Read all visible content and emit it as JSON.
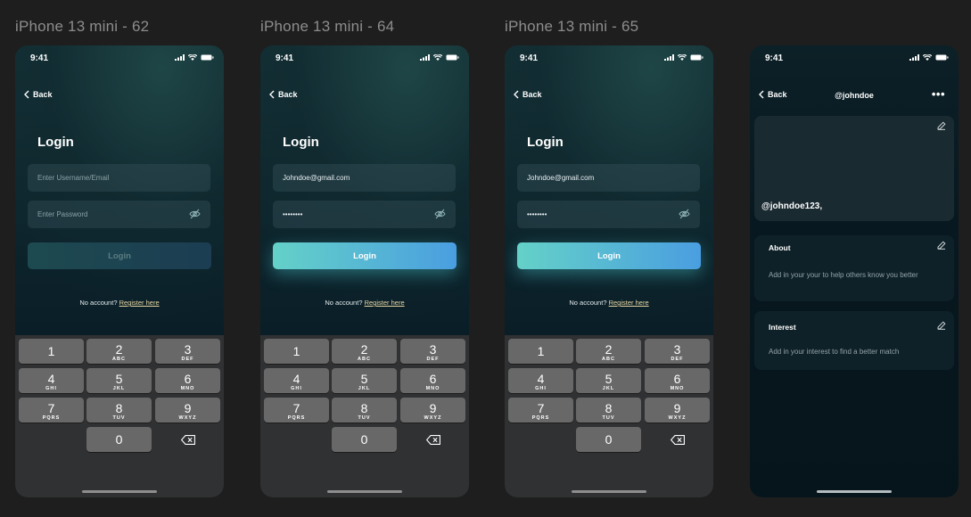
{
  "frames": [
    {
      "label": "iPhone 13 mini - 62"
    },
    {
      "label": "iPhone 13 mini - 64"
    },
    {
      "label": "iPhone 13 mini - 65"
    }
  ],
  "status_time": "9:41",
  "back_label": "Back",
  "login": {
    "title": "Login",
    "username_placeholder": "Enter Username/Email",
    "password_placeholder": "Enter Password",
    "username_value": "Johndoe@gmail.com",
    "password_value": "••••••••",
    "button_label": "Login",
    "no_account": "No account?",
    "register_link": "Register here"
  },
  "keyboard": {
    "keys": [
      {
        "num": "1",
        "sub": ""
      },
      {
        "num": "2",
        "sub": "ABC"
      },
      {
        "num": "3",
        "sub": "DEF"
      },
      {
        "num": "4",
        "sub": "GHI"
      },
      {
        "num": "5",
        "sub": "JKL"
      },
      {
        "num": "6",
        "sub": "MNO"
      },
      {
        "num": "7",
        "sub": "PQRS"
      },
      {
        "num": "8",
        "sub": "TUV"
      },
      {
        "num": "9",
        "sub": "WXYZ"
      },
      {
        "num": "0",
        "sub": ""
      }
    ]
  },
  "profile": {
    "header_handle": "@johndoe",
    "more_label": "•••",
    "cover_handle": "@johndoe123,",
    "about_title": "About",
    "about_text": "Add in your your to help others know you better",
    "interest_title": "Interest",
    "interest_text": "Add in your interest to find a better match"
  },
  "colors": {
    "button_gradient_start": "#64d1c8",
    "button_gradient_end": "#4a9ee0",
    "register_link": "#e8d7a4",
    "canvas": "#1e1e1e"
  }
}
